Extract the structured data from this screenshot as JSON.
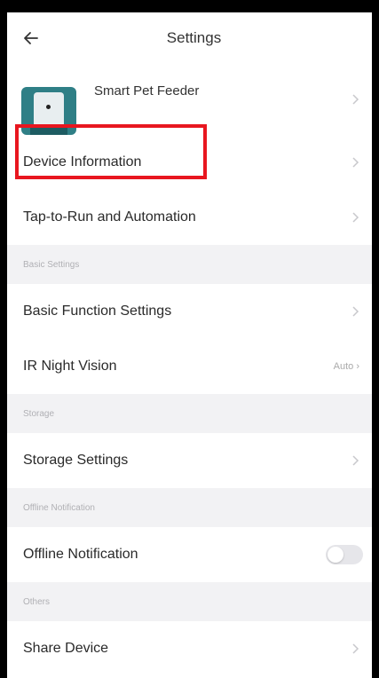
{
  "header": {
    "title": "Settings",
    "back_icon": "back-arrow-icon"
  },
  "device": {
    "name": "Smart Pet Feeder",
    "thumb_icon": "pet-feeder-thumbnail"
  },
  "rows": {
    "device_information": "Device Information",
    "tap_to_run": "Tap-to-Run and Automation",
    "basic_function": "Basic Function Settings",
    "ir_night_vision": "IR Night Vision",
    "ir_night_vision_value": "Auto",
    "storage_settings": "Storage Settings",
    "offline_notification": "Offline Notification",
    "share_device": "Share Device"
  },
  "sections": {
    "basic": "Basic Settings",
    "storage": "Storage",
    "offline": "Offline Notification",
    "others": "Others"
  },
  "state": {
    "offline_notification_enabled": false
  },
  "colors": {
    "highlight": "#e8161f",
    "section_bg": "#f2f2f4"
  }
}
